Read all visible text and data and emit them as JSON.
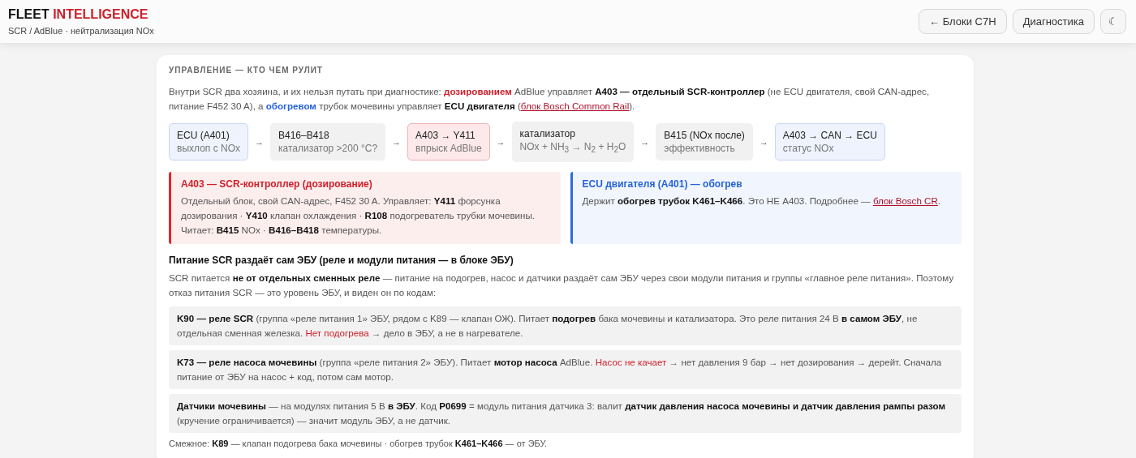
{
  "header": {
    "title": [
      {
        "kind": "plain",
        "t": "FLEET"
      },
      {
        "kind": "accent",
        "t": "INTELLIGENCE"
      }
    ],
    "subtitle": "SCR / AdBlue · нейтрализация NOx",
    "buttons": [
      {
        "kind": "text",
        "label": "← Блоки C7H"
      },
      {
        "kind": "text",
        "label": "Диагностика"
      },
      {
        "kind": "icon",
        "label": "☾"
      }
    ]
  },
  "section": {
    "heading": "УПРАВЛЕНИЕ — КТО ЧЕМ РУЛИТ",
    "intro": [
      {
        "kind": "text",
        "t": "Внутри SCR два хозяина, и их нельзя путать при диагностике: "
      },
      {
        "kind": "red",
        "t": "дозированием"
      },
      {
        "kind": "text",
        "t": " AdBlue управляет **A403 — отдельный SCR-контроллер** (не ECU двигателя, свой CAN-адрес, питание F452 30 A), а "
      },
      {
        "kind": "blue",
        "t": "обогревом"
      },
      {
        "kind": "text",
        "t": " трубок мочевины управляет **ECU двигателя** ("
      },
      {
        "kind": "link",
        "t": "блок Bosch Common Rail"
      },
      {
        "kind": "text",
        "t": ")."
      }
    ],
    "flow": [
      {
        "kind": "blue",
        "title": "ECU (A401)",
        "note": "выхлоп с NOx"
      },
      {
        "kind": "grey",
        "title": "B416–B418",
        "note": "катализатор >200 °C?"
      },
      {
        "kind": "red",
        "title": "A403 → Y411",
        "note": "впрыск AdBlue"
      },
      {
        "kind": "grey",
        "title": "катализатор",
        "note": "NOx + NH$_{3}$ → N$_{2}$ + H$_{2}$O"
      },
      {
        "kind": "grey",
        "title": "B415 (NOx после)",
        "note": "эффективность"
      },
      {
        "kind": "blue",
        "title": "A403 → CAN → ECU",
        "note": "статус NOx"
      }
    ],
    "flow_arrows": [
      "→",
      "→",
      "→",
      "→",
      "→"
    ],
    "panels": [
      {
        "kind": "red",
        "title": "A403 — SCR-контроллер (дозирование)",
        "body": [
          {
            "kind": "text",
            "t": "Отдельный блок, свой CAN-адрес, F452 30 A. Управляет: **Y411** форсунка дозирования · **Y410** клапан охлаждения · **R108** подогреватель трубки мочевины. Читает: **B415** NOx · **B416–B418** температуры."
          }
        ]
      },
      {
        "kind": "blue",
        "title": "ECU двигателя (A401) — обогрев",
        "body": [
          {
            "kind": "text",
            "t": "Держит **обогрев трубок K461–K466**. Это НЕ A403. Подробнее — "
          },
          {
            "kind": "link",
            "t": "блок Bosch CR"
          },
          {
            "kind": "text",
            "t": "."
          }
        ]
      }
    ],
    "subheading": "Питание SCR раздаёт сам ЭБУ (реле и модули питания — в блоке ЭБУ)",
    "power_text": "SCR питается **не от отдельных сменных реле** — питание на подогрев, насос и датчики раздаёт сам ЭБУ через свои модули питания и группы «главное реле питания». Поэтому отказ питания SCR — это уровень ЭБУ, и виден он по кодам:",
    "notes": [
      [
        {
          "kind": "text",
          "t": "**K90 — реле SCR** (группа «реле питания 1» ЭБУ, рядом с K89 — клапан ОЖ). Питает **подогрев** бака мочевины и катализатора. Это реле питания 24 В **в самом ЭБУ**, не отдельная сменная железка. "
        },
        {
          "kind": "alert",
          "t": "Нет подогрева"
        },
        {
          "kind": "text",
          "t": " → дело в ЭБУ, а не в нагревателе."
        }
      ],
      [
        {
          "kind": "text",
          "t": "**K73 — реле насоса мочевины** (группа «реле питания 2» ЭБУ). Питает **мотор насоса** AdBlue. "
        },
        {
          "kind": "alert",
          "t": "Насос не качает"
        },
        {
          "kind": "text",
          "t": " → нет давления 9 бар → нет дозирования → дерейт. Сначала питание от ЭБУ на насос + код, потом сам мотор."
        }
      ],
      [
        {
          "kind": "text",
          "t": "**Датчики мочевины** — на модулях питания 5 В **в ЭБУ**. Код **P0699** = модуль питания датчика 3: валит **датчик давления насоса мочевины и датчик давления рампы разом** (кручение ограничивается) — значит модуль ЭБУ, а не датчик."
        }
      ]
    ],
    "footer": "Смежное: **K89** — клапан подогрева бака мочевины · обогрев трубок **K461–K466** — от ЭБУ."
  }
}
